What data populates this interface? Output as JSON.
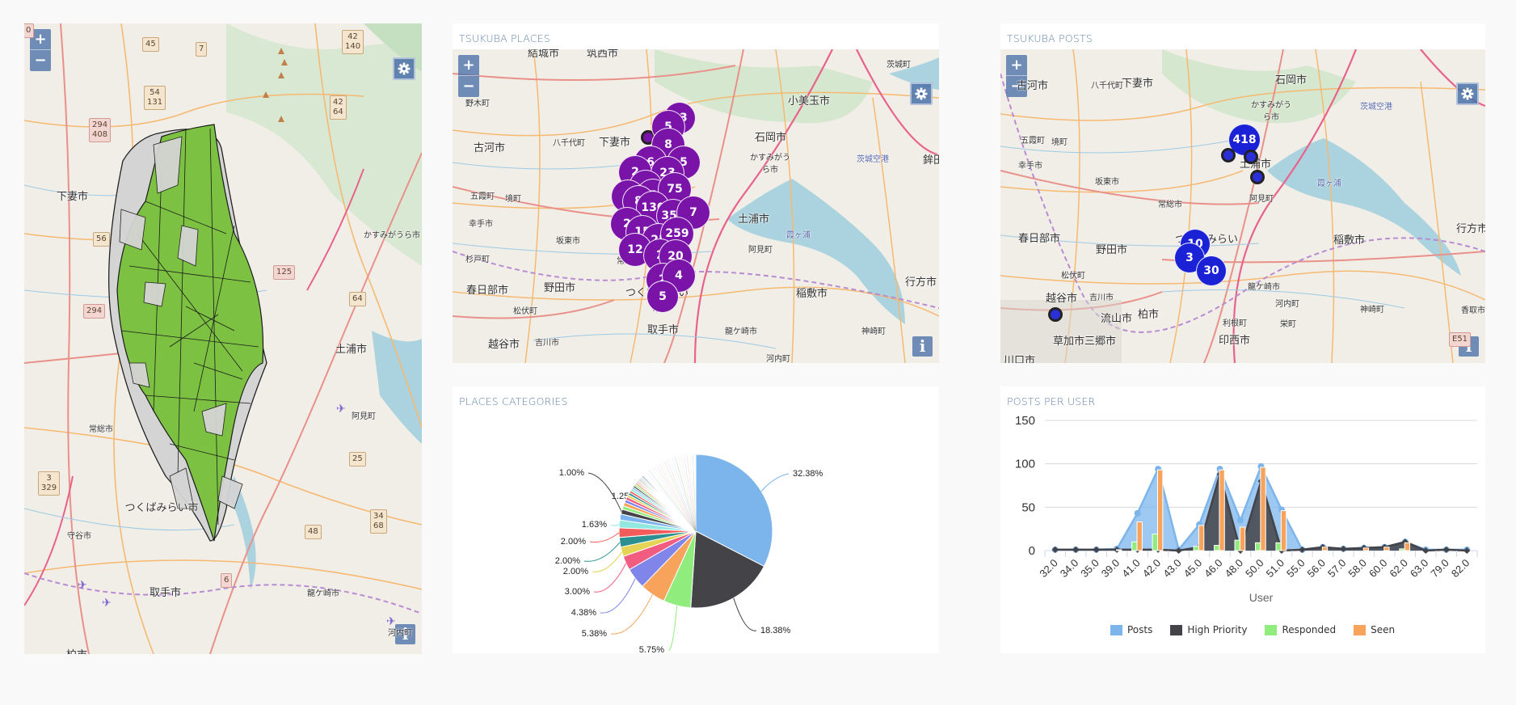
{
  "left_map": {
    "zoom_in": "+",
    "zoom_out": "−",
    "info": "i",
    "cities": [
      "下妻市",
      "かすみがうら市",
      "土浦市",
      "阿見町",
      "常総市",
      "つくばみらい市",
      "守谷市",
      "取手市",
      "龍ケ崎市",
      "河内町",
      "柏市"
    ],
    "shields": [
      "45",
      "7",
      "42\n140",
      "54\n131",
      "42\n64",
      "294\n408",
      "56",
      "125",
      "64",
      "294",
      "3\n329",
      "25",
      "48",
      "34\n68",
      "6",
      "0"
    ]
  },
  "places_map": {
    "title": "TSUKUBA PLACES",
    "zoom_in": "+",
    "zoom_out": "−",
    "info": "i",
    "cities": [
      "結城市",
      "筑西市",
      "野木町",
      "古河市",
      "八千代町",
      "下妻市",
      "小美玉市",
      "石岡市",
      "茨城町",
      "かすみがうら市",
      "茨城空港",
      "鉾田",
      "五霞町",
      "境町",
      "幸手市",
      "坂東市",
      "常総市",
      "杉戸町",
      "土浦市",
      "霞ヶ浦",
      "阿見町",
      "行方市",
      "春日部市",
      "野田市",
      "つくばみらい市",
      "稲敷市",
      "松伏町",
      "越谷市",
      "吉川市",
      "取手市",
      "龍ケ崎市",
      "神崎町",
      "河内町"
    ],
    "clusters": [
      "13",
      "5",
      "8",
      "6",
      "5",
      "2",
      "23",
      "4",
      "4",
      "5",
      "75",
      "8",
      "130",
      "355",
      "7",
      "2",
      "15",
      "25",
      "259",
      "12",
      "2",
      "20",
      "2",
      "4",
      "5"
    ]
  },
  "posts_map": {
    "title": "TSUKUBA POSTS",
    "zoom_in": "+",
    "zoom_out": "−",
    "info": "i",
    "cities": [
      "古河市",
      "八千代町",
      "下妻市",
      "石岡市",
      "茨城空港",
      "かすみがうら市",
      "五霞町",
      "境町",
      "幸手市",
      "坂東市",
      "常総市",
      "土浦市",
      "霞ヶ浦",
      "阿見町",
      "行方市",
      "春日部市",
      "野田市",
      "つくばみらい",
      "稲敷市",
      "松伏町",
      "越谷市",
      "吉川市",
      "龍ケ崎市",
      "神崎町",
      "香取市",
      "河内町",
      "流山市",
      "柏市",
      "利根町",
      "栄町",
      "草加市",
      "三郷市",
      "印西市",
      "川口市"
    ],
    "clusters": [
      "418",
      "10",
      "3",
      "30"
    ],
    "shield": "E51"
  },
  "places_categories": {
    "title": "PLACES CATEGORIES"
  },
  "posts_per_user": {
    "title": "POSTS PER USER"
  },
  "chart_data": [
    {
      "type": "pie",
      "title": "PLACES CATEGORIES",
      "labels_shown": [
        "32.38%",
        "18.38%",
        "5.75%",
        "5.38%",
        "4.38%",
        "3.00%",
        "2.00%",
        "2.00%",
        "2.00%",
        "1.63%",
        "1.25%",
        "1.00%"
      ],
      "values": [
        32.38,
        18.38,
        5.75,
        5.38,
        4.38,
        3.0,
        2.0,
        2.0,
        2.0,
        1.63,
        1.25,
        1.0,
        0.75,
        0.75,
        0.63,
        0.63,
        0.5,
        0.5,
        0.5,
        0.5,
        0.38,
        0.38,
        0.38,
        0.38,
        0.25,
        0.25,
        0.25,
        0.25,
        0.25,
        0.25,
        0.25,
        0.25,
        0.13,
        0.13,
        0.13,
        0.13,
        0.13,
        0.13,
        0.13,
        0.13,
        10.96
      ],
      "colors": [
        "#7cb5ec",
        "#434348",
        "#90ed7d",
        "#f7a35c",
        "#8085e9",
        "#f15c80",
        "#e4d354",
        "#2b908f",
        "#f45b5b",
        "#91e8e1"
      ]
    },
    {
      "type": "bar",
      "title": "POSTS PER USER",
      "xlabel": "User",
      "ylabel": "",
      "ylim": [
        0,
        150
      ],
      "yticks": [
        0,
        50,
        100,
        150
      ],
      "grid": true,
      "legend": "bottom",
      "categories": [
        "32.0",
        "34.0",
        "35.0",
        "39.0",
        "41.0",
        "42.0",
        "43.0",
        "45.0",
        "46.0",
        "48.0",
        "50.0",
        "51.0",
        "55.0",
        "56.0",
        "57.0",
        "58.0",
        "60.0",
        "62.0",
        "63.0",
        "79.0",
        "82.0"
      ],
      "series": [
        {
          "name": "Posts",
          "kind": "area",
          "color": "#7cb5ec",
          "values": [
            1,
            1,
            1,
            2,
            43,
            94,
            1,
            30,
            94,
            35,
            97,
            47,
            1,
            4,
            2,
            3,
            4,
            10,
            1,
            1,
            1
          ]
        },
        {
          "name": "High Priority",
          "kind": "area",
          "color": "#434348",
          "values": [
            1,
            1,
            1,
            1,
            1,
            1,
            0,
            4,
            88,
            0,
            80,
            0,
            1,
            4,
            2,
            3,
            4,
            10,
            0,
            1,
            0
          ]
        },
        {
          "name": "Responded",
          "kind": "column",
          "color": "#90ed7d",
          "values": [
            0,
            0,
            0,
            0,
            10,
            19,
            0,
            5,
            6,
            12,
            9,
            9,
            0,
            0,
            0,
            0,
            0,
            2,
            0,
            0,
            0
          ]
        },
        {
          "name": "Seen",
          "kind": "column",
          "color": "#f7a35c",
          "values": [
            0,
            0,
            0,
            1,
            33,
            93,
            0,
            29,
            93,
            27,
            96,
            46,
            0,
            4,
            0,
            3,
            4,
            9,
            0,
            0,
            0
          ]
        }
      ]
    }
  ]
}
